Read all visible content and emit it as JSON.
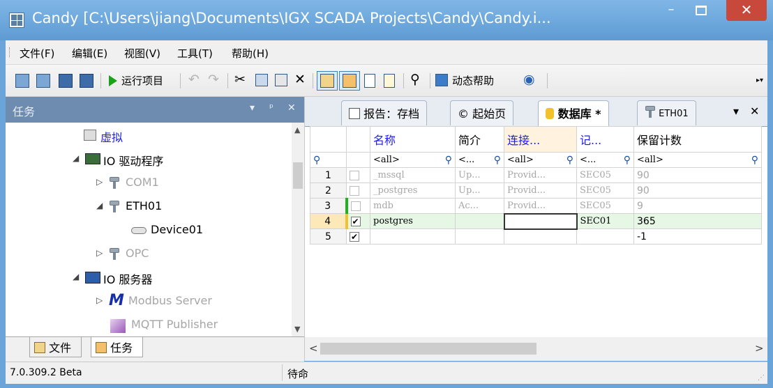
{
  "window": {
    "title": "Candy [C:\\Users\\jiang\\Documents\\IGX SCADA Projects\\Candy\\Candy.i...",
    "min": "–",
    "close": "✕"
  },
  "menu": [
    "文件(F)",
    "编辑(E)",
    "视图(V)",
    "工具(T)",
    "帮助(H)"
  ],
  "toolbar": {
    "run_project": "运行项目",
    "dynamic_help": "动态帮助"
  },
  "left_panel": {
    "title": "任务",
    "controls": [
      "▾",
      "ᵖ",
      "✕"
    ],
    "tree": [
      {
        "label": "虚拟",
        "style": "blue"
      },
      {
        "label": "IO 驱动程序",
        "style": "normal"
      },
      {
        "label": "COM1",
        "style": "dim"
      },
      {
        "label": "ETH01",
        "style": "normal"
      },
      {
        "label": "Device01",
        "style": "normal"
      },
      {
        "label": "OPC",
        "style": "dim"
      },
      {
        "label": "IO 服务器",
        "style": "normal"
      },
      {
        "label": "Modbus Server",
        "style": "dim"
      },
      {
        "label": "MQTT Publisher",
        "style": "dim"
      }
    ],
    "tabs": [
      "文件",
      "任务"
    ]
  },
  "doc_tabs": [
    {
      "label": "报告：存档"
    },
    {
      "label": "起始页"
    },
    {
      "label": "数据库 *"
    },
    {
      "label": "ETH01"
    }
  ],
  "grid": {
    "headers": [
      "名称",
      "简介",
      "连接...",
      "记...",
      "保留计数"
    ],
    "filters": [
      "<all>",
      "<...",
      "<all>",
      "<...",
      "<all>"
    ],
    "rows": [
      {
        "num": "1",
        "checked": false,
        "name": "_mssql",
        "intro": "Up...",
        "conn": "Provid...",
        "rec": "SEC05",
        "keep": "90",
        "gray": true
      },
      {
        "num": "2",
        "checked": false,
        "name": "_postgres",
        "intro": "Up...",
        "conn": "Provid...",
        "rec": "SEC05",
        "keep": "90",
        "gray": true
      },
      {
        "num": "3",
        "checked": false,
        "name": "mdb",
        "intro": "Ac...",
        "conn": "Provid...",
        "rec": "SEC05",
        "keep": "9",
        "gray": true
      },
      {
        "num": "4",
        "checked": true,
        "name": "postgres",
        "intro": "",
        "conn": "",
        "rec": "SEC01",
        "keep": "365",
        "gray": false
      },
      {
        "num": "5",
        "checked": true,
        "name": "",
        "intro": "",
        "conn": "",
        "rec": "",
        "keep": "-1",
        "gray": false
      }
    ]
  },
  "status": {
    "version": "7.0.309.2 Beta",
    "state": "待命"
  }
}
